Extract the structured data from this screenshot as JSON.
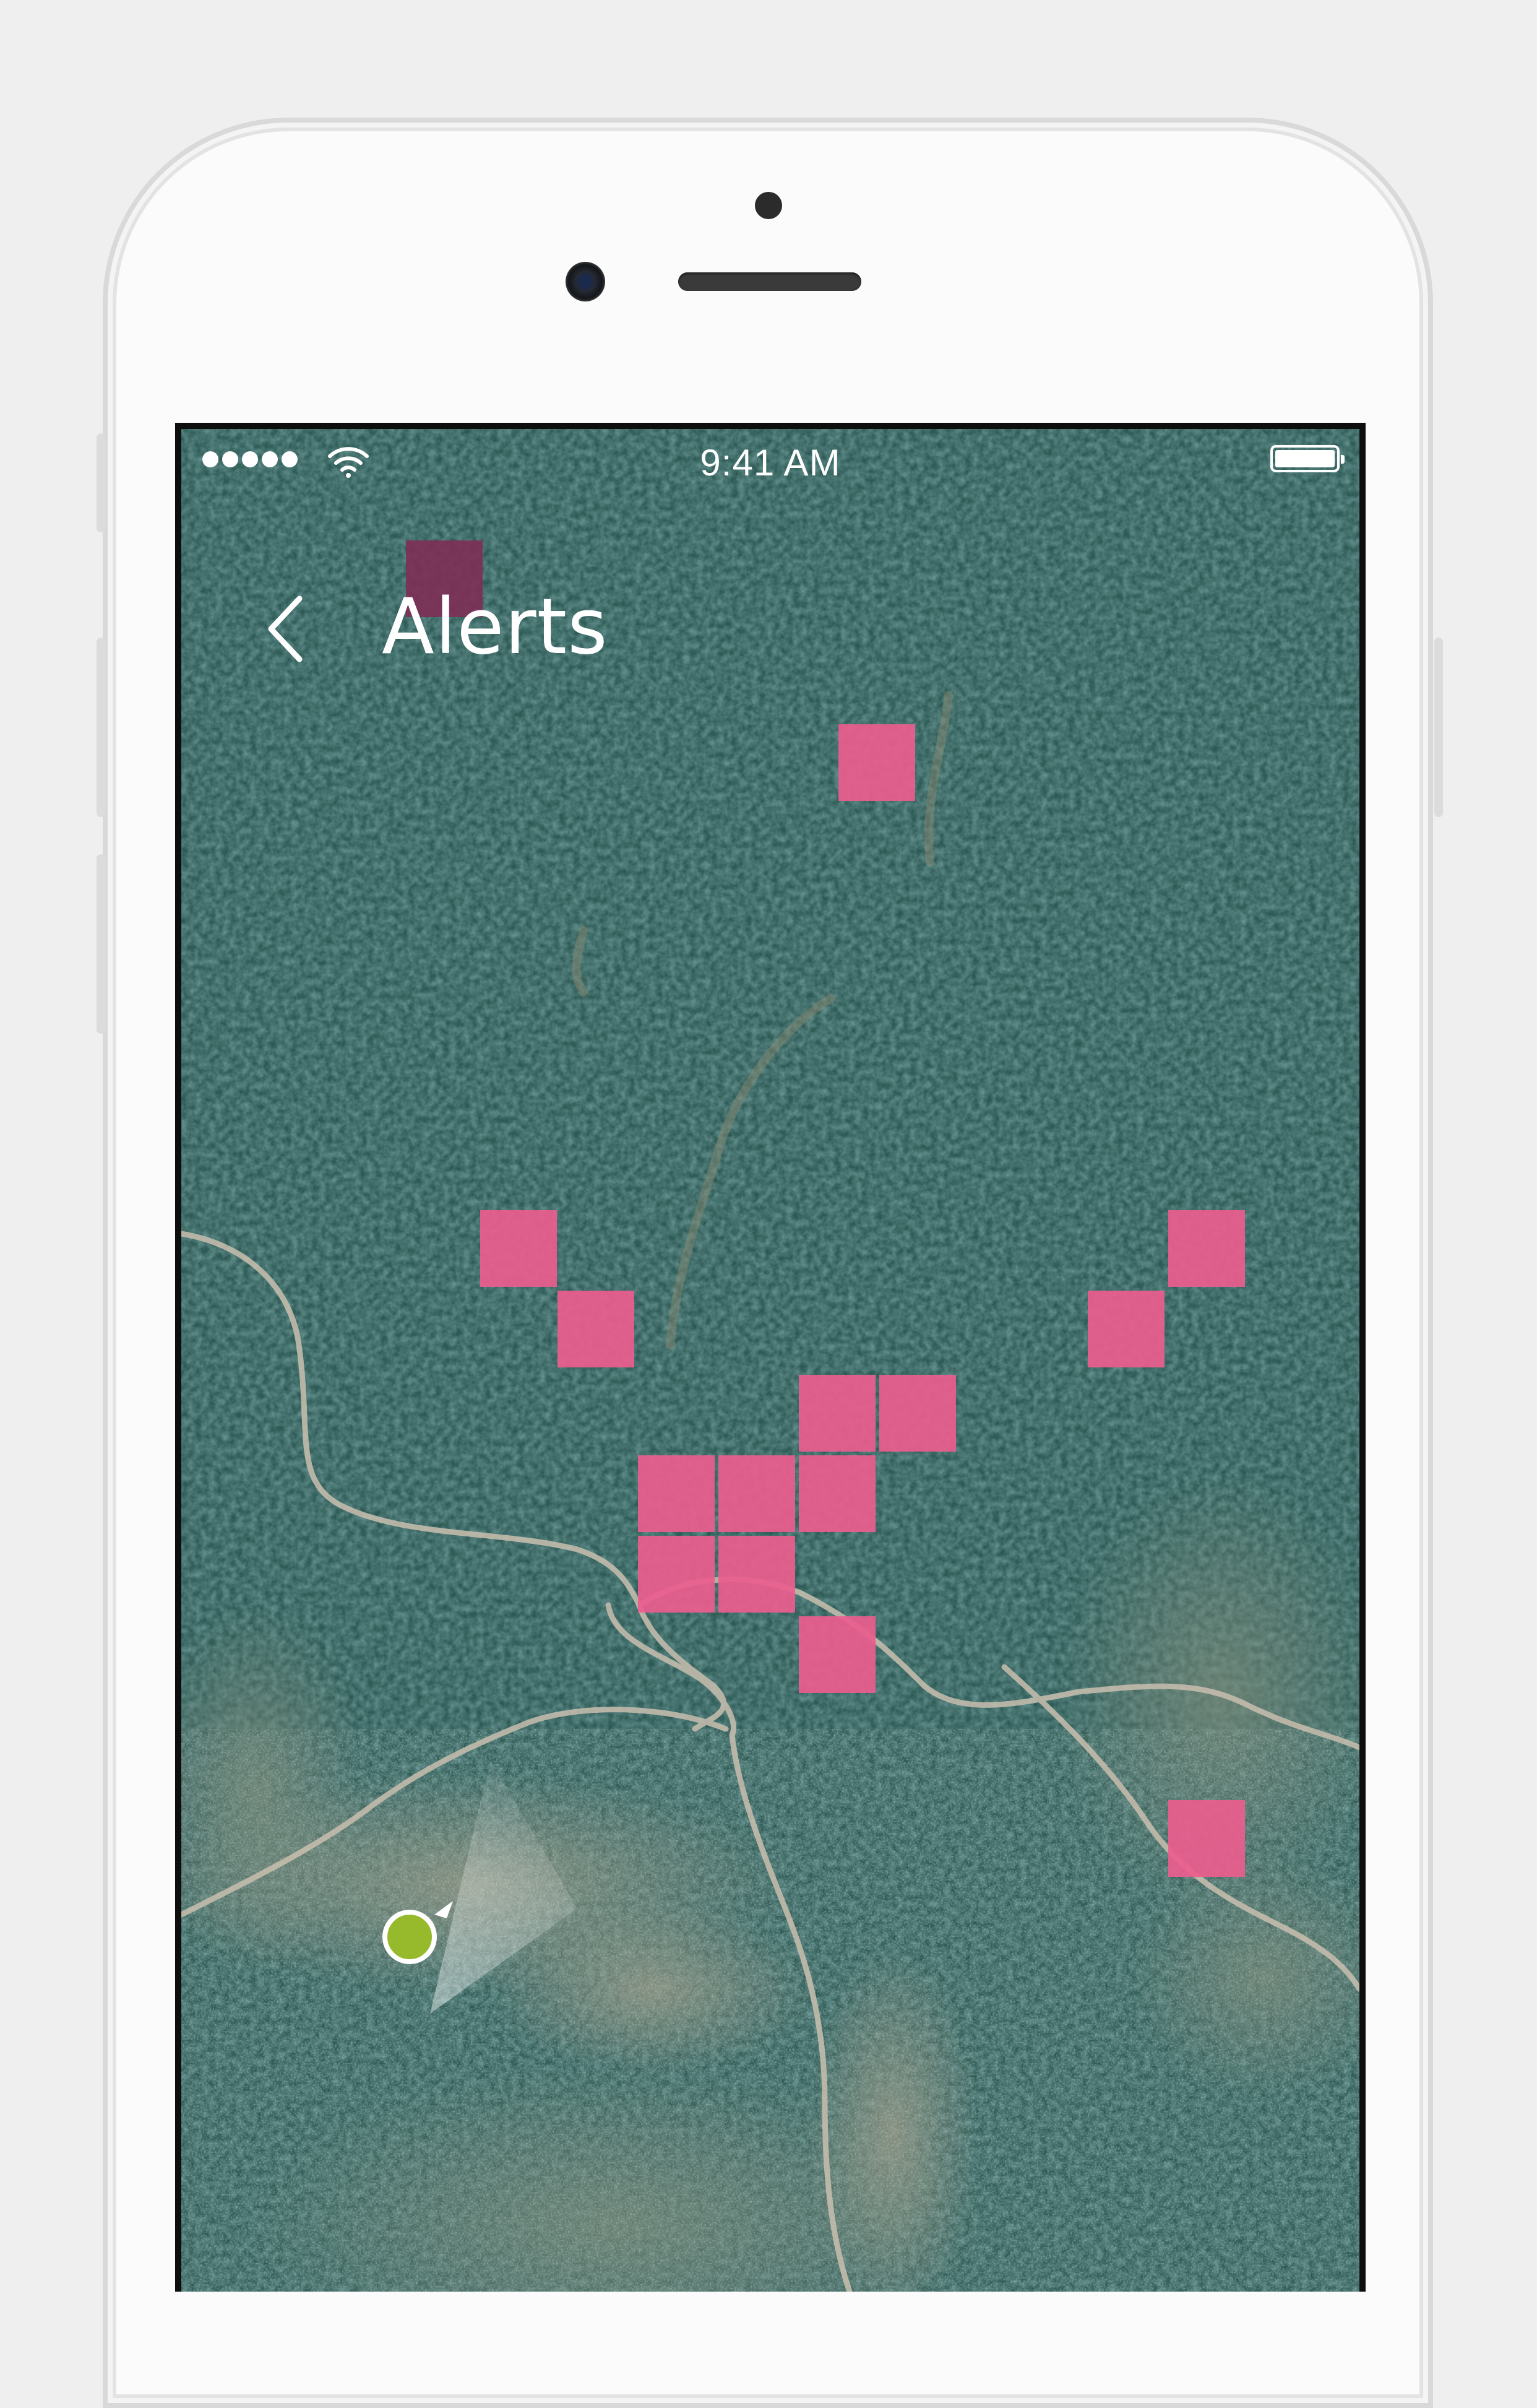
{
  "status_bar": {
    "time": "9:41 AM",
    "signal_icon": "signal-dots-icon",
    "wifi_icon": "wifi-icon",
    "battery_icon": "battery-icon"
  },
  "nav": {
    "title": "Alerts",
    "back_icon": "chevron-left-icon"
  },
  "map": {
    "type": "satellite",
    "alert_color": "#ec5d8e",
    "alert_dark_color": "#7e2f55",
    "user_location_color": "#97ba2c",
    "alert_cell_count": 16
  },
  "colors": {
    "forest": "#2c5753",
    "road": "#c9bfaf",
    "page_background": "#efefef",
    "phone_body": "#fbfbfb"
  }
}
